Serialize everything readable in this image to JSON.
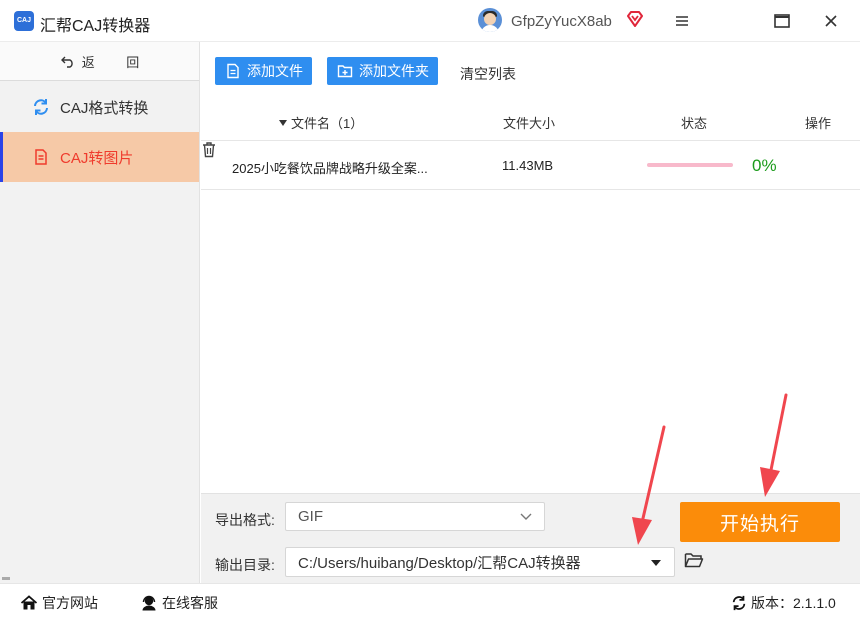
{
  "window": {
    "logo_text": "CAJ",
    "title": "汇帮CAJ转换器",
    "username": "GfpZyYucX8ab"
  },
  "sidebar": {
    "back_label": "返 回",
    "items": [
      {
        "label": "CAJ格式转换",
        "icon": "refresh-icon",
        "active": false
      },
      {
        "label": "CAJ转图片",
        "icon": "document-icon",
        "active": true
      }
    ]
  },
  "toolbar": {
    "add_file": "添加文件",
    "add_folder": "添加文件夹",
    "clear_list": "清空列表"
  },
  "table": {
    "columns": [
      "文件名（1）",
      "文件大小",
      "状态",
      "操作"
    ],
    "rows": [
      {
        "name": "2025小吃餐饮品牌战略升级全案...",
        "size": "11.43MB",
        "progress": 0,
        "progress_label": "0%"
      }
    ]
  },
  "settings": {
    "format_label": "导出格式:",
    "format_value": "GIF",
    "dir_label": "输出目录:",
    "dir_value": "C:/Users/huibang/Desktop/汇帮CAJ转换器",
    "start_button": "开始执行"
  },
  "footer": {
    "website": "官方网站",
    "service": "在线客服",
    "version_label": "版本：",
    "version": "2.1.1.0"
  },
  "colors": {
    "accent_blue": "#2f8ef0",
    "start_orange": "#fb8c0a",
    "active_nav_bg": "#f6c9a7",
    "active_nav_text": "#ef3b2d",
    "progress_pink": "#f8b9cb",
    "percent_green": "#1c9b1c",
    "annotation_red": "#f0464e"
  }
}
